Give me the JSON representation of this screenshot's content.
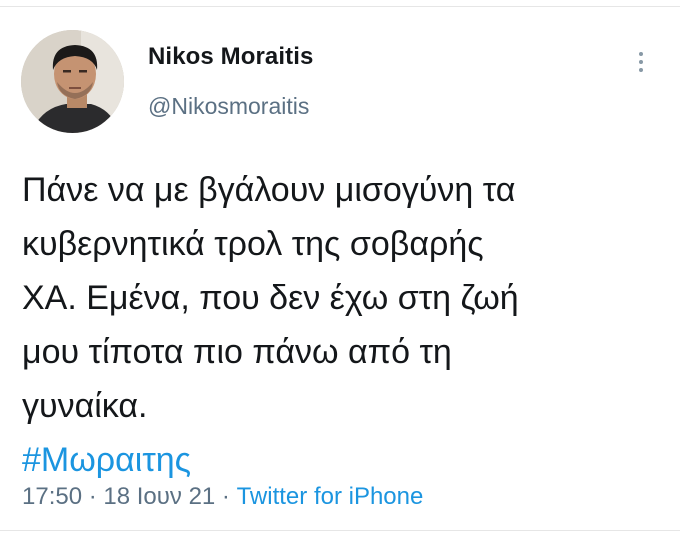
{
  "author": {
    "name": "Nikos Moraitis",
    "handle": "@Nikosmoraitis"
  },
  "tweet": {
    "lines": [
      "Πάνε να με βγάλουν μισογύνη τα",
      "κυβερνητικά τρολ της σοβαρής",
      "ΧΑ. Εμένα, που δεν έχω στη ζωή",
      "μου τίποτα πιο πάνω από τη",
      "γυναίκα."
    ],
    "hashtag": "#Μωραιτης"
  },
  "meta": {
    "time": "17:50",
    "separator1": " · ",
    "date": "18 Ιουν 21",
    "separator2": " · ",
    "source": "Twitter for iPhone"
  },
  "icons": {
    "more": "more-vertical-icon",
    "avatar": "profile-photo"
  },
  "colors": {
    "link": "#1b95e0",
    "secondary_text": "#5b7083",
    "primary_text": "#14171a"
  }
}
